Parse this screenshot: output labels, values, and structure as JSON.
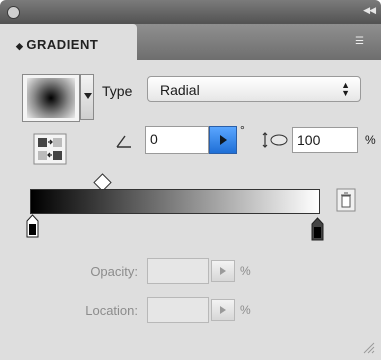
{
  "panel": {
    "tab_label": "GRADIENT",
    "tab_glyph": "◆"
  },
  "type": {
    "label": "Type",
    "value": "Radial"
  },
  "angle": {
    "value": "0",
    "unit": "°"
  },
  "aspect": {
    "value": "100",
    "unit": "%"
  },
  "opacity": {
    "label": "Opacity:",
    "value": "",
    "unit": "%"
  },
  "location": {
    "label": "Location:",
    "value": "",
    "unit": "%"
  },
  "gradient": {
    "start_color": "#000000",
    "end_color": "#ffffff",
    "midpoint_location": 0.25
  },
  "colors": {
    "accent": "#2f7fe6",
    "panel_bg": "#dedede",
    "tabbar": "#7a7a7a"
  }
}
